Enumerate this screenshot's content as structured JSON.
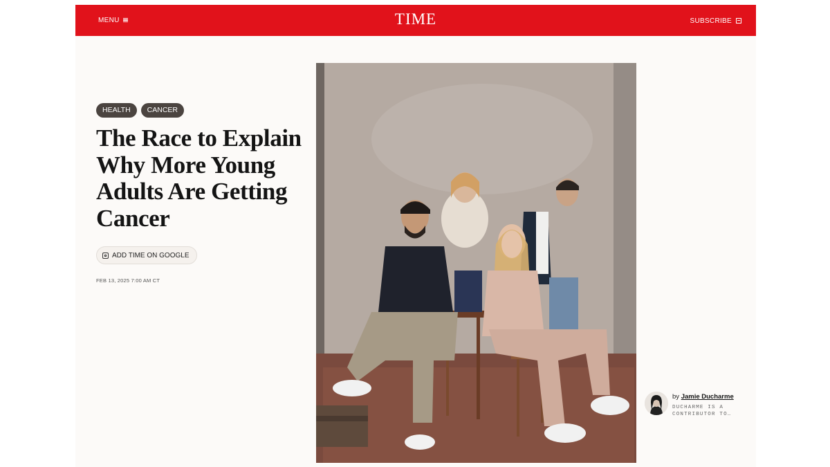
{
  "header": {
    "menu_label": "MENU",
    "logo": "TIME",
    "subscribe_label": "SUBSCRIBE",
    "brand_color": "#e1121b"
  },
  "article": {
    "tags": [
      "HEALTH",
      "CANCER"
    ],
    "headline": "The Race to Explain Why More Young Adults Are Getting Cancer",
    "google_button_label": "ADD TIME ON GOOGLE",
    "date": "FEB 13, 2025 7:00 AM CT"
  },
  "author": {
    "by_prefix": "by",
    "name": "Jamie Ducharme",
    "bio": "DUCHARME IS A CONTRIBUTOR TO…"
  },
  "icons": {
    "menu": "hamburger-icon",
    "subscribe": "newspaper-icon",
    "google": "google-source-icon"
  }
}
